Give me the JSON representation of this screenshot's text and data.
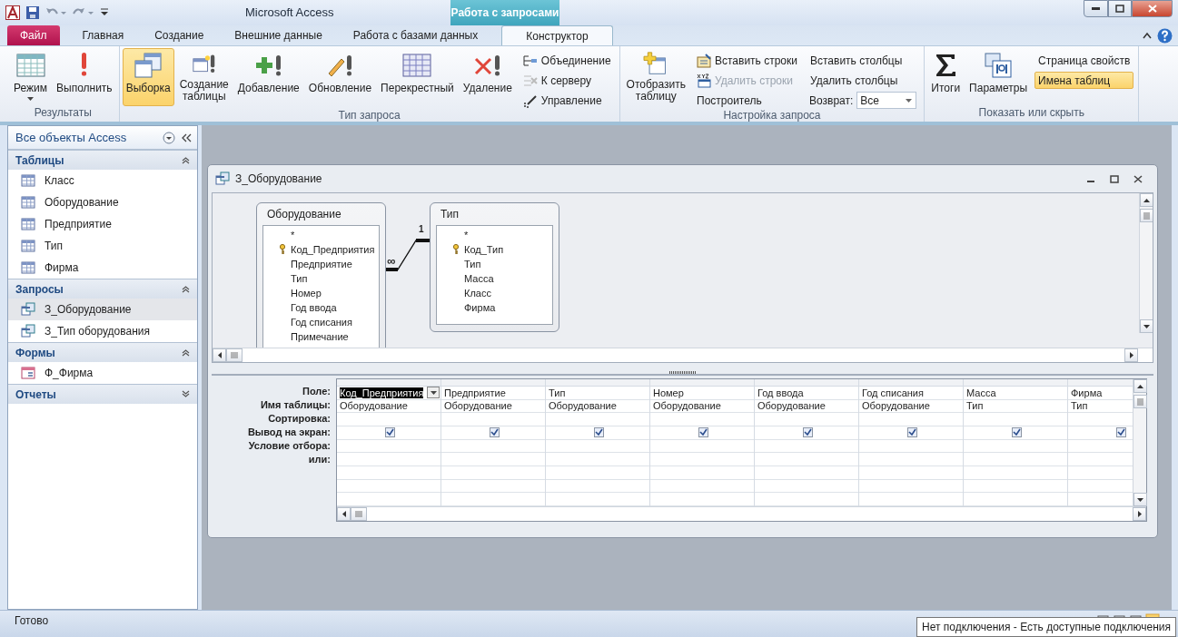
{
  "window": {
    "title": "Microsoft Access",
    "context_tab": "Работа с запросами"
  },
  "ribbon_tabs": [
    {
      "label": "Файл",
      "kind": "file",
      "selected": false
    },
    {
      "label": "Главная",
      "kind": "tab",
      "selected": false
    },
    {
      "label": "Создание",
      "kind": "tab",
      "selected": false
    },
    {
      "label": "Внешние данные",
      "kind": "tab",
      "selected": false
    },
    {
      "label": "Работа с базами данных",
      "kind": "tab",
      "selected": false
    },
    {
      "label": "Конструктор",
      "kind": "tab",
      "selected": true
    }
  ],
  "ribbon_groups": [
    {
      "label": "Результаты",
      "items": [
        {
          "kind": "large",
          "label": "Режим",
          "dropdown": true,
          "selected": false
        },
        {
          "kind": "large",
          "label": "Выполнить",
          "dropdown": false,
          "selected": false
        }
      ]
    },
    {
      "label": "Тип запроса",
      "items": [
        {
          "kind": "large",
          "label": "Выборка",
          "dropdown": false,
          "selected": true
        },
        {
          "kind": "large",
          "label": "Создание\nтаблицы",
          "dropdown": false,
          "selected": false
        },
        {
          "kind": "large",
          "label": "Добавление",
          "dropdown": false,
          "selected": false
        },
        {
          "kind": "large",
          "label": "Обновление",
          "dropdown": false,
          "selected": false
        },
        {
          "kind": "large",
          "label": "Перекрестный",
          "dropdown": false,
          "selected": false
        },
        {
          "kind": "large",
          "label": "Удаление",
          "dropdown": false,
          "selected": false
        },
        {
          "kind": "column",
          "items": [
            {
              "kind": "small",
              "label": "Объединение",
              "disabled": false,
              "selected": false
            },
            {
              "kind": "small",
              "label": "К серверу",
              "disabled": false,
              "selected": false
            },
            {
              "kind": "small",
              "label": "Управление",
              "disabled": false,
              "selected": false
            }
          ]
        }
      ]
    },
    {
      "label": "Настройка запроса",
      "items": [
        {
          "kind": "large",
          "label": "Отобразить\nтаблицу",
          "dropdown": false,
          "selected": false
        },
        {
          "kind": "column",
          "items": [
            {
              "kind": "small",
              "label": "Вставить строки",
              "disabled": false,
              "selected": false
            },
            {
              "kind": "small",
              "label": "Удалить строки",
              "disabled": true,
              "selected": false
            },
            {
              "kind": "small",
              "label": "Построитель",
              "disabled": false,
              "selected": false
            }
          ]
        },
        {
          "kind": "column",
          "items": [
            {
              "kind": "small",
              "label": "Вставить столбцы",
              "disabled": false,
              "selected": false
            },
            {
              "kind": "small",
              "label": "Удалить столбцы",
              "disabled": false,
              "selected": false
            },
            {
              "kind": "combo",
              "label": "Возврат:",
              "value": "Все"
            }
          ]
        }
      ]
    },
    {
      "label": "Показать или скрыть",
      "items": [
        {
          "kind": "large",
          "label": "Итоги",
          "dropdown": false,
          "selected": false
        },
        {
          "kind": "large",
          "label": "Параметры",
          "dropdown": false,
          "selected": false
        },
        {
          "kind": "column",
          "items": [
            {
              "kind": "small",
              "label": "Страница свойств",
              "disabled": false,
              "selected": false
            },
            {
              "kind": "small",
              "label": "Имена таблиц",
              "disabled": false,
              "selected": true
            }
          ]
        }
      ]
    }
  ],
  "nav_pane": {
    "title": "Все объекты Access",
    "groups": [
      {
        "title": "Таблицы",
        "kind": "table",
        "expanded": true,
        "items": [
          {
            "label": "Класс",
            "selected": false
          },
          {
            "label": "Оборудование",
            "selected": false
          },
          {
            "label": "Предприятие",
            "selected": false
          },
          {
            "label": "Тип",
            "selected": false
          },
          {
            "label": "Фирма",
            "selected": false
          }
        ]
      },
      {
        "title": "Запросы",
        "kind": "query",
        "expanded": true,
        "items": [
          {
            "label": "З_Оборудование",
            "selected": true
          },
          {
            "label": "З_Тип оборудования",
            "selected": false
          }
        ]
      },
      {
        "title": "Формы",
        "kind": "form",
        "expanded": true,
        "items": [
          {
            "label": "Ф_Фирма",
            "selected": false
          }
        ]
      },
      {
        "title": "Отчеты",
        "expanded": false
      }
    ]
  },
  "query_window": {
    "title": "З_Оборудование",
    "tables": [
      {
        "name": "Оборудование",
        "fields": [
          {
            "name": "*",
            "key": false
          },
          {
            "name": "Код_Предприятия",
            "key": true
          },
          {
            "name": "Предприятие",
            "key": false
          },
          {
            "name": "Тип",
            "key": false
          },
          {
            "name": "Номер",
            "key": false
          },
          {
            "name": "Год ввода",
            "key": false
          },
          {
            "name": "Год списания",
            "key": false
          },
          {
            "name": "Примечание",
            "key": false
          }
        ]
      },
      {
        "name": "Тип",
        "fields": [
          {
            "name": "*",
            "key": false
          },
          {
            "name": "Код_Тип",
            "key": true
          },
          {
            "name": "Тип",
            "key": false
          },
          {
            "name": "Масса",
            "key": false
          },
          {
            "name": "Класс",
            "key": false
          },
          {
            "name": "Фирма",
            "key": false
          }
        ]
      }
    ],
    "relationship": {
      "many_label": "∞",
      "one_label": "1"
    },
    "grid": {
      "row_labels": [
        "Поле:",
        "Имя таблицы:",
        "Сортировка:",
        "Вывод на экран:",
        "Условие отбора:",
        "или:"
      ],
      "columns": [
        {
          "field": "Код_Предприятия",
          "table": "Оборудование",
          "show": true,
          "selected": true
        },
        {
          "field": "Предприятие",
          "table": "Оборудование",
          "show": true,
          "selected": false
        },
        {
          "field": "Тип",
          "table": "Оборудование",
          "show": true,
          "selected": false
        },
        {
          "field": "Номер",
          "table": "Оборудование",
          "show": true,
          "selected": false
        },
        {
          "field": "Год ввода",
          "table": "Оборудование",
          "show": true,
          "selected": false
        },
        {
          "field": "Год списания",
          "table": "Оборудование",
          "show": true,
          "selected": false
        },
        {
          "field": "Масса",
          "table": "Тип",
          "show": true,
          "selected": false
        },
        {
          "field": "Фирма",
          "table": "Тип",
          "show": true,
          "selected": false
        }
      ]
    }
  },
  "status_bar": {
    "text": "Готово",
    "tooltip": "Нет подключения - Есть доступные подключения"
  }
}
